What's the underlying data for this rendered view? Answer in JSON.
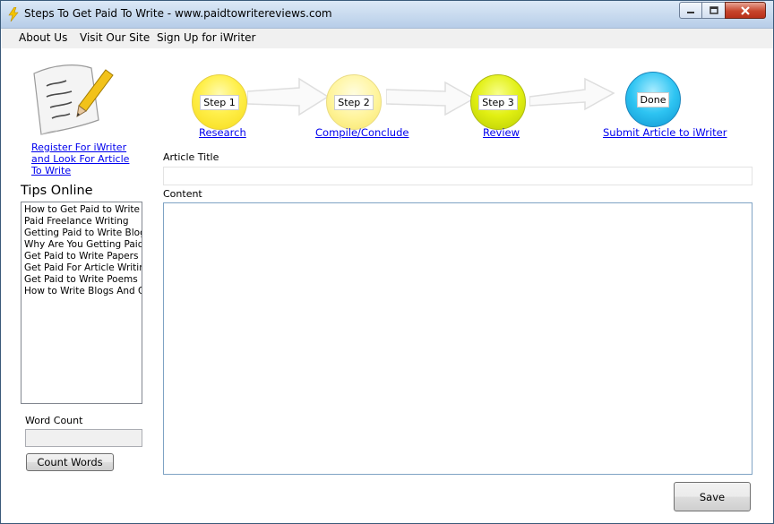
{
  "window": {
    "title": "Steps To Get Paid To Write - www.paidtowritereviews.com"
  },
  "menu": [
    "About Us",
    "Visit Our Site",
    "Sign Up for iWriter"
  ],
  "sidebar": {
    "register_link_lines": [
      "Register For iWriter",
      "and Look For Article",
      "To Write"
    ],
    "tips_heading": "Tips Online",
    "tips": [
      "How to Get Paid to Write a",
      "Paid Freelance Writing",
      "Getting Paid to Write Blogs",
      "Why Are You Getting Paid t",
      "Get Paid to Write Papers",
      "Get Paid For Article Writing",
      "Get Paid to Write Poems",
      "How to Write Blogs And Ge"
    ],
    "word_count_label": "Word Count",
    "word_count_value": "",
    "count_button": "Count Words"
  },
  "steps": [
    {
      "badge": "Step 1",
      "link": "Research",
      "color": "#f6e41f"
    },
    {
      "badge": "Step 2",
      "link": "Compile/Conclude",
      "color": "#fff49a"
    },
    {
      "badge": "Step 3",
      "link": "Review",
      "color": "#dbe90e"
    },
    {
      "badge": "Done",
      "link": "Submit Article to iWriter",
      "color": "#22b5e8"
    }
  ],
  "form": {
    "title_label": "Article Title",
    "title_value": "",
    "content_label": "Content",
    "content_value": "",
    "save_button": "Save"
  },
  "icons": {
    "app": "lightning-icon",
    "logo": "paper-pencil-icon"
  }
}
